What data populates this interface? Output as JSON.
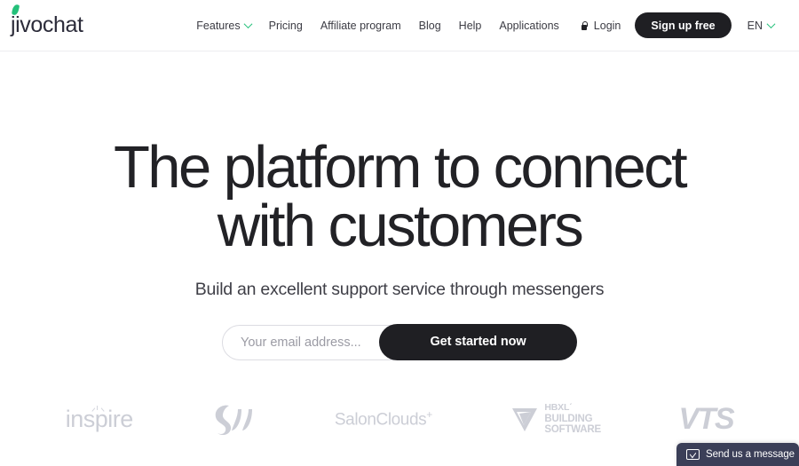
{
  "header": {
    "logo": {
      "text": "jivochat",
      "accent_color": "#24c07a"
    },
    "nav_items": [
      {
        "label": "Features",
        "has_chevron": true,
        "icon": "chevron-down-icon"
      },
      {
        "label": "Pricing",
        "has_chevron": false
      },
      {
        "label": "Affiliate program",
        "has_chevron": false
      },
      {
        "label": "Blog",
        "has_chevron": false
      },
      {
        "label": "Help",
        "has_chevron": false
      },
      {
        "label": "Applications",
        "has_chevron": false
      }
    ],
    "login": {
      "label": "Login",
      "icon": "lock-icon"
    },
    "signup": {
      "label": "Sign up free",
      "background": "#1f1f23"
    },
    "language": {
      "label": "EN",
      "icon": "chevron-down-icon"
    }
  },
  "hero": {
    "headline_line1": "The platform to connect",
    "headline_line2": "with customers",
    "subheadline": "Build an excellent support service through messengers",
    "form": {
      "email_placeholder": "Your email address...",
      "email_value": "",
      "cta_label": "Get started now"
    }
  },
  "logo_strip": {
    "brands": [
      {
        "name": "inspire",
        "label": "inspire",
        "icon": "sparkle-icon"
      },
      {
        "name": "wave-mark",
        "label": "",
        "icon": "wave-logo-icon"
      },
      {
        "name": "salonclouds",
        "label": "SalonClouds",
        "superscript": "+"
      },
      {
        "name": "hbxl",
        "line1": "HBXLˊ",
        "line2": "BUILDING",
        "line3": "SOFTWARE",
        "icon": "triangle-logo-icon"
      },
      {
        "name": "vts",
        "label": "VTS"
      }
    ]
  },
  "chat_widget": {
    "label": "Send us a message",
    "icon": "chat-chevron-icon",
    "background": "#3b3f58"
  }
}
